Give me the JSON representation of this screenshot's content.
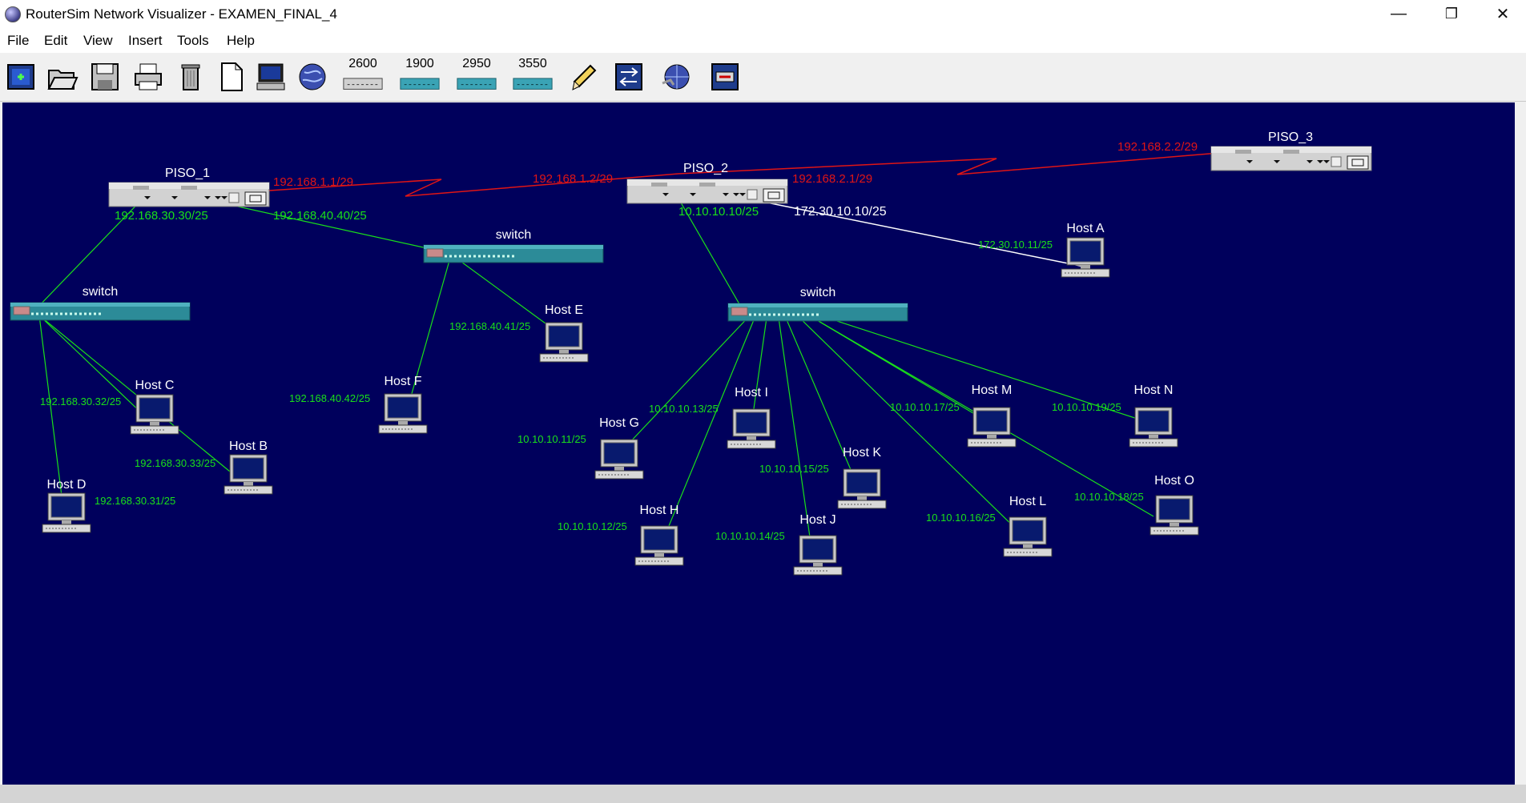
{
  "window": {
    "title": "RouterSim Network Visualizer - EXAMEN_FINAL_4",
    "minimize_glyph": "—",
    "restore_glyph": "❐",
    "close_glyph": "✕"
  },
  "menu": [
    "File",
    "Edit",
    "View",
    "Insert",
    "Tools",
    "Help"
  ],
  "toolbar": {
    "items": [
      "new-icon",
      "open-icon",
      "save-icon",
      "print-icon",
      "delete-icon",
      "blank-page-icon",
      "workstation-icon",
      "internet-cloud-icon",
      "router-2600-icon",
      "switch-1900-icon",
      "switch-2950-icon",
      "switch-3550-icon",
      "pencil-icon",
      "connector-icon",
      "network-globe-icon",
      "console-icon"
    ],
    "device_labels": {
      "r2600": "2600",
      "s1900": "1900",
      "s2950": "2950",
      "s3550": "3550"
    }
  },
  "colors": {
    "canvas_bg": "#00005c",
    "serial_link": "#e01515",
    "ethernet_link": "#19e019",
    "special_link": "#ffffff"
  },
  "routers": {
    "piso1": {
      "name": "PISO_1"
    },
    "piso2": {
      "name": "PISO_2"
    },
    "piso3": {
      "name": "PISO_3"
    }
  },
  "switches": {
    "sw1": {
      "name": "switch"
    },
    "sw2": {
      "name": "switch"
    },
    "sw3": {
      "name": "switch"
    }
  },
  "hosts": {
    "A": {
      "name": "Host A",
      "ip": "172.30.10.11/25"
    },
    "B": {
      "name": "Host B",
      "ip": "192.168.30.33/25"
    },
    "C": {
      "name": "Host C",
      "ip": "192.168.30.32/25"
    },
    "D": {
      "name": "Host D",
      "ip": "192.168.30.31/25"
    },
    "E": {
      "name": "Host E",
      "ip": "192.168.40.41/25"
    },
    "F": {
      "name": "Host F",
      "ip": "192.168.40.42/25"
    },
    "G": {
      "name": "Host G",
      "ip": "10.10.10.11/25"
    },
    "H": {
      "name": "Host H",
      "ip": "10.10.10.12/25"
    },
    "I": {
      "name": "Host I",
      "ip": "10.10.10.13/25"
    },
    "J": {
      "name": "Host J",
      "ip": "10.10.10.14/25"
    },
    "K": {
      "name": "Host K",
      "ip": "10.10.10.15/25"
    },
    "L": {
      "name": "Host L",
      "ip": "10.10.10.16/25"
    },
    "M": {
      "name": "Host M",
      "ip": "10.10.10.17/25"
    },
    "N": {
      "name": "Host N",
      "ip": "10.10.10.19/25"
    },
    "O": {
      "name": "Host O",
      "ip": "10.10.10.18/25"
    }
  },
  "interfaces": {
    "piso1_serial": "192.168.1.1/29",
    "piso2_serial_left": "192.168.1.2/29",
    "piso2_serial_right": "192.168.2.1/29",
    "piso3_serial": "192.168.2.2/29",
    "piso1_eth_a": "192.168.30.30/25",
    "piso1_eth_b": "192.168.40.40/25",
    "piso2_eth_a": "10.10.10.10/25",
    "piso2_eth_b": "172.30.10.10/25"
  }
}
